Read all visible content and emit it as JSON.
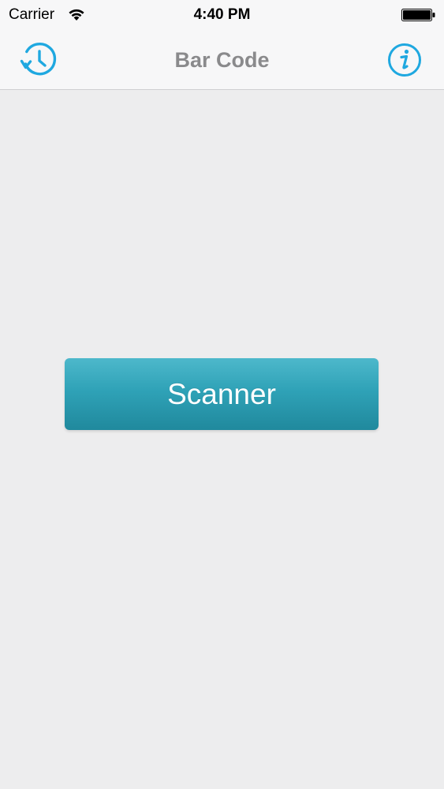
{
  "status_bar": {
    "carrier": "Carrier",
    "time": "4:40 PM",
    "wifi_icon": "wifi-icon",
    "battery_icon": "battery-icon"
  },
  "nav_bar": {
    "title": "Bar Code",
    "left_icon": "history-clock-icon",
    "right_icon": "info-icon"
  },
  "main": {
    "scanner_label": "Scanner"
  },
  "colors": {
    "accent": "#1fa8e0",
    "button_top": "#4db8cb",
    "button_bottom": "#20899d",
    "background": "#ededee",
    "title_gray": "#8a8a8c"
  }
}
